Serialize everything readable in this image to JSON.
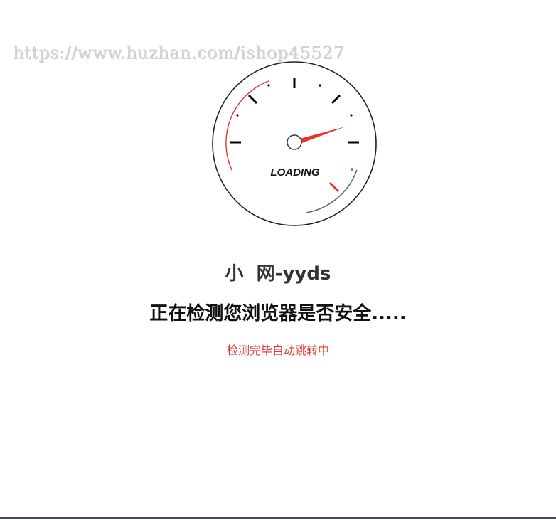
{
  "watermark": "https://www.huzhan.com/ishop45527",
  "gauge": {
    "label": "LOADING",
    "accent_color": "#e8332d"
  },
  "site_title": "小  网-yyds",
  "headline": "正在检测您浏览器是否安全.....",
  "subline": "检测完毕自动跳转中",
  "colors": {
    "accent": "#e8332d",
    "text_dark": "#111111",
    "text_title": "#333333"
  }
}
